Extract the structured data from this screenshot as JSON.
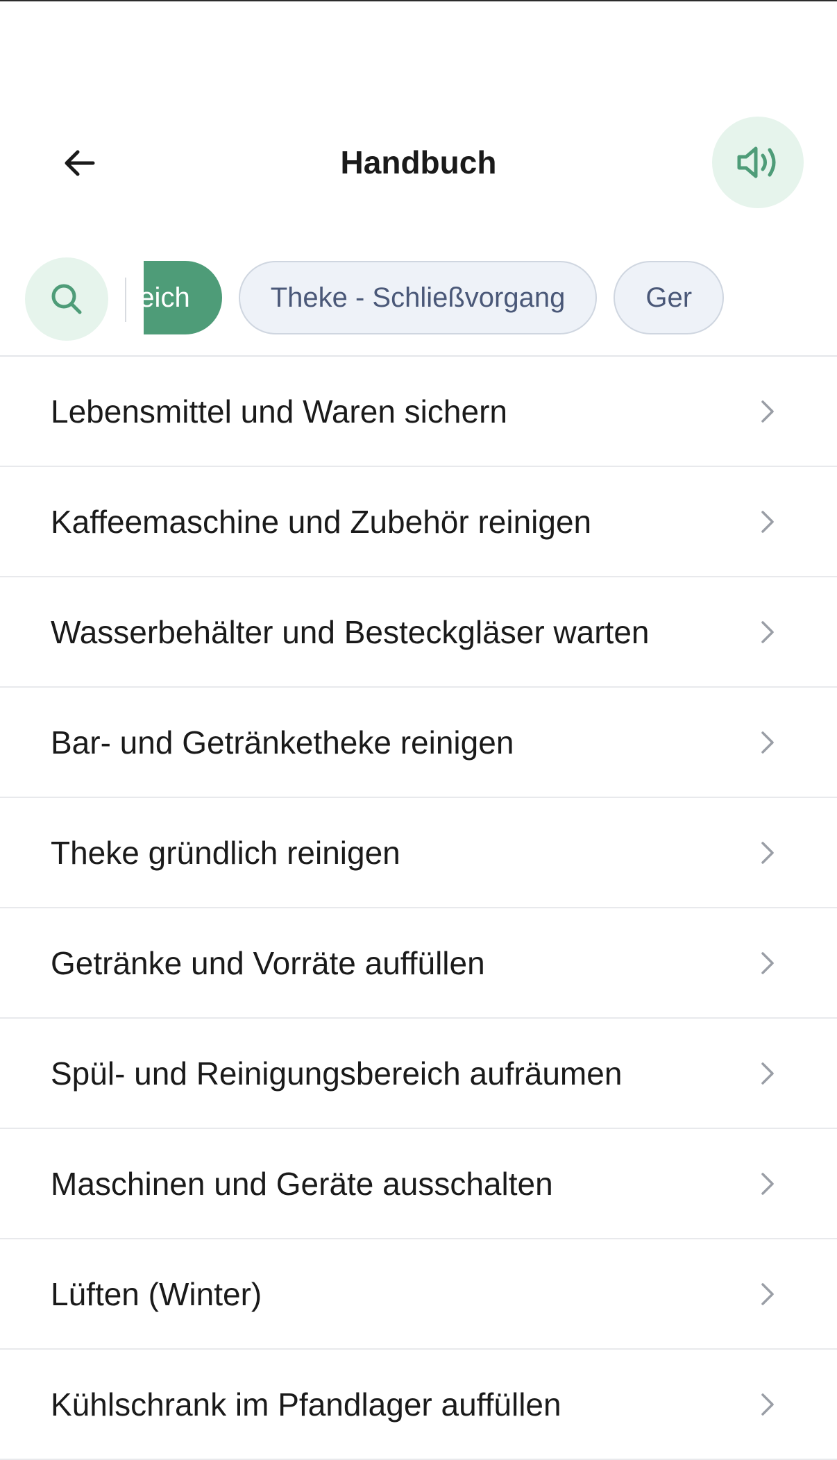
{
  "header": {
    "title": "Handbuch",
    "back_icon": "arrow-left-icon",
    "audio_icon": "speaker-icon",
    "accent_color": "#4e9c78"
  },
  "filters": {
    "search_icon": "search-icon",
    "chips": [
      {
        "label": "Arbeitsbereich",
        "active": true
      },
      {
        "label": "Theke - Schließvorgang",
        "active": false
      },
      {
        "label": "Ger",
        "active": false
      }
    ]
  },
  "items": [
    {
      "label": "Lebensmittel und Waren sichern"
    },
    {
      "label": "Kaffeemaschine und Zubehör reinigen"
    },
    {
      "label": "Wasserbehälter und Besteckgläser warten"
    },
    {
      "label": "Bar- und Getränketheke reinigen"
    },
    {
      "label": "Theke gründlich reinigen"
    },
    {
      "label": "Getränke und Vorräte auffüllen"
    },
    {
      "label": "Spül- und Reinigungsbereich aufräumen"
    },
    {
      "label": "Maschinen und Geräte ausschalten"
    },
    {
      "label": "Lüften (Winter)"
    },
    {
      "label": "Kühlschrank im Pfandlager auffüllen"
    }
  ]
}
